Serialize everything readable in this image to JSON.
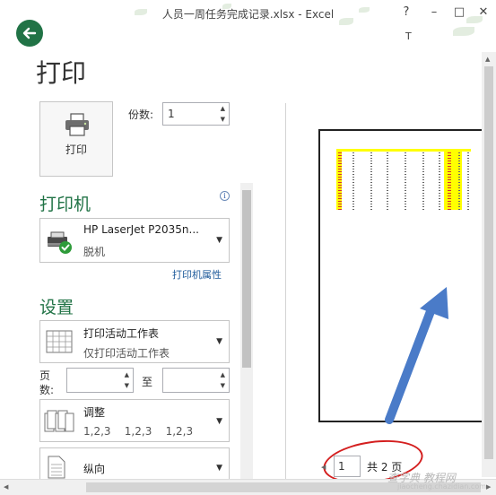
{
  "window": {
    "title": "人员一周任务完成记录.xlsx - Excel",
    "help": "?",
    "minimize": "–",
    "restore": "□",
    "close": "✕",
    "user_initial": "T"
  },
  "page_title": "打印",
  "print_button": {
    "label": "打印"
  },
  "copies": {
    "label": "份数:",
    "value": "1"
  },
  "printer": {
    "heading": "打印机",
    "name": "HP LaserJet P2035n...",
    "status": "脱机",
    "properties_link": "打印机属性"
  },
  "settings": {
    "heading": "设置",
    "scope": {
      "title": "打印活动工作表",
      "subtitle": "仅打印活动工作表"
    },
    "pages_label": "页数:",
    "pages_from": "",
    "to_label": "至",
    "pages_to": "",
    "collate": {
      "title": "调整",
      "subtitle": "1,2,3    1,2,3    1,2,3"
    },
    "orientation": {
      "title": "纵向"
    }
  },
  "navigation": {
    "current_page": "1",
    "total_label": "共 2 页"
  },
  "watermark": {
    "text": "查字典 教程网",
    "url": "jiaocheng.chazidian.com"
  },
  "colors": {
    "accent": "#217346",
    "highlight_yellow": "#ffff00",
    "annotation_red": "#d41f1f",
    "arrow_blue": "#4a7bc8"
  }
}
